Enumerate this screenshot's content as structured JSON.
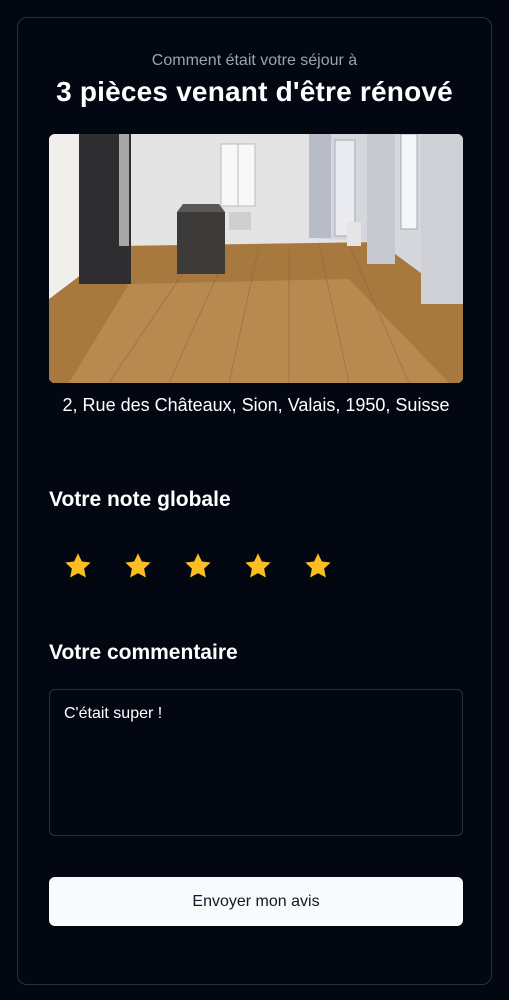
{
  "header": {
    "subtitle": "Comment était votre séjour à",
    "title": "3 pièces venant d'être rénové"
  },
  "listing": {
    "photo_icon": "apartment-photo",
    "address": "2, Rue des Châteaux, Sion, Valais, 1950, Suisse"
  },
  "rating": {
    "label": "Votre note globale",
    "value": 5,
    "max": 5,
    "star_color": "#fbbf24"
  },
  "comment": {
    "label": "Votre commentaire",
    "value": "C'était super !"
  },
  "submit": {
    "label": "Envoyer mon avis"
  },
  "colors": {
    "background": "#030712",
    "border": "#2a3040",
    "button_bg": "#f8fafc"
  }
}
